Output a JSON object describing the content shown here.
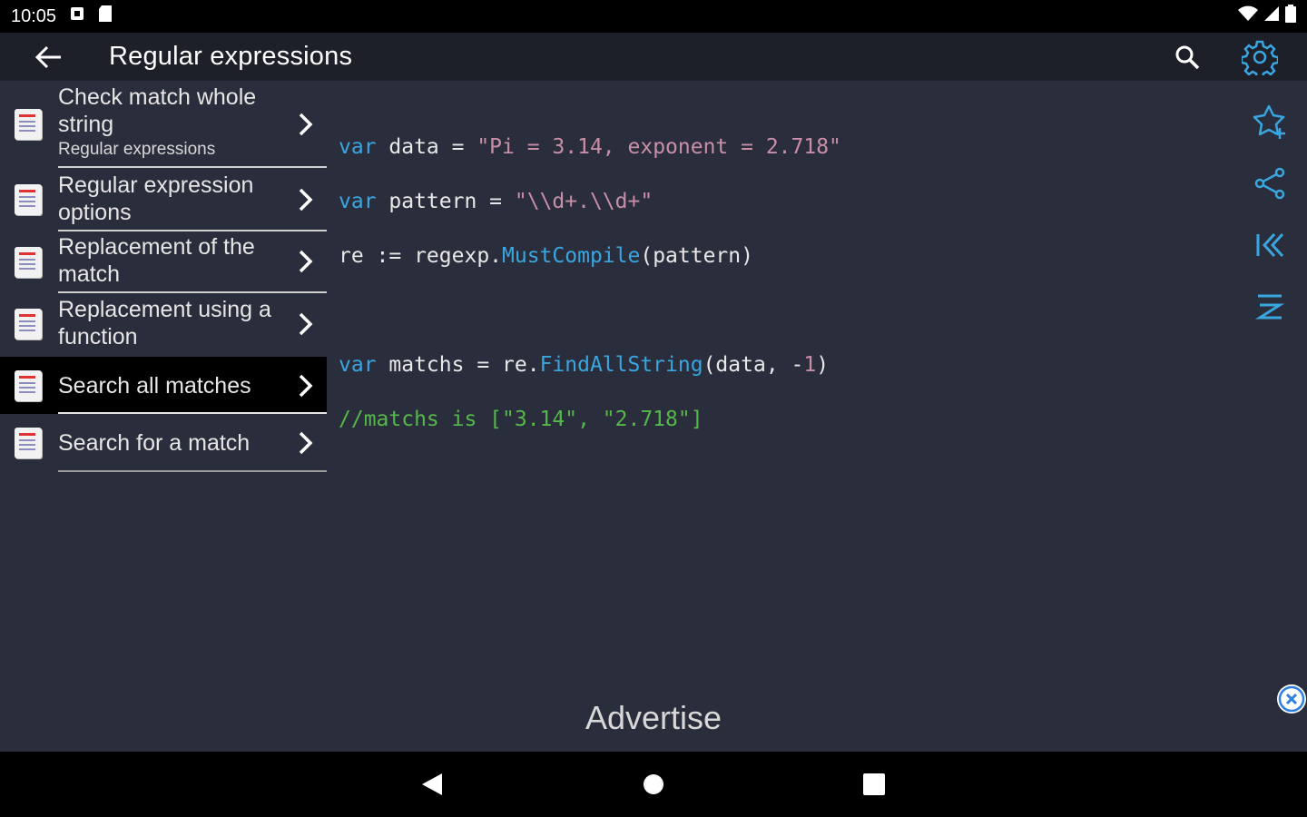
{
  "status_bar": {
    "time": "10:05"
  },
  "app_bar": {
    "title": "Regular expressions"
  },
  "sidebar": {
    "items": [
      {
        "label": "Check match whole string",
        "subtitle": "Regular expressions"
      },
      {
        "label": "Regular expression options"
      },
      {
        "label": "Replacement of the match"
      },
      {
        "label": "Replacement using a function"
      },
      {
        "label": "Search all matches"
      },
      {
        "label": "Search for a match"
      }
    ]
  },
  "code": {
    "line1": {
      "kw": "var",
      "a": " data = ",
      "s": "\"Pi = 3.14, exponent = 2.718\""
    },
    "line2": {
      "kw": "var",
      "a": " pattern = ",
      "s": "\"\\\\d+.\\\\d+\""
    },
    "line3": {
      "a": "re := regexp.",
      "fn": "MustCompile",
      "b": "(pattern)"
    },
    "line5": {
      "kw": "var",
      "a": " matchs = re.",
      "fn": "FindAllString",
      "b": "(data, -",
      "n": "1",
      "c": ")"
    },
    "line6": {
      "cmt": "//matchs is [\"3.14\", \"2.718\"]"
    }
  },
  "ad": {
    "label": "Advertise"
  },
  "colors": {
    "accent": "#3aa6e0",
    "background": "#2a2d3c",
    "string": "#c98fa8",
    "comment": "#55b84a"
  }
}
